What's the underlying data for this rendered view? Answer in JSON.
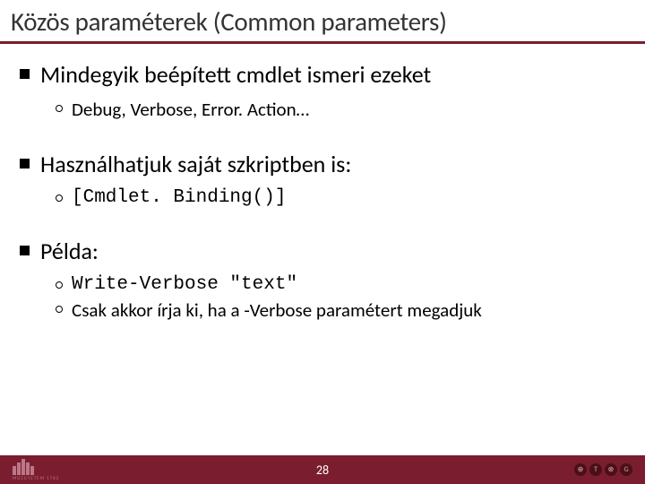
{
  "title": "Közös paraméterek (Common parameters)",
  "bullets": [
    {
      "text": "Mindegyik beépített cmdlet ismeri ezeket",
      "sub": [
        {
          "text": "Debug, Verbose, Error. Action…",
          "mono": false
        }
      ]
    },
    {
      "text": "Használhatjuk saját szkriptben is:",
      "sub": [
        {
          "text": "[Cmdlet. Binding()]",
          "mono": true
        }
      ]
    },
    {
      "text": "Példa:",
      "sub": [
        {
          "text": "Write-Verbose \"text\"",
          "mono": true
        },
        {
          "text": "Csak akkor írja ki, ha a -Verbose paramétert megadjuk",
          "mono": false
        }
      ]
    }
  ],
  "footer": {
    "page_number": "28",
    "uni_label": "MŰEGYETEM 1782"
  }
}
